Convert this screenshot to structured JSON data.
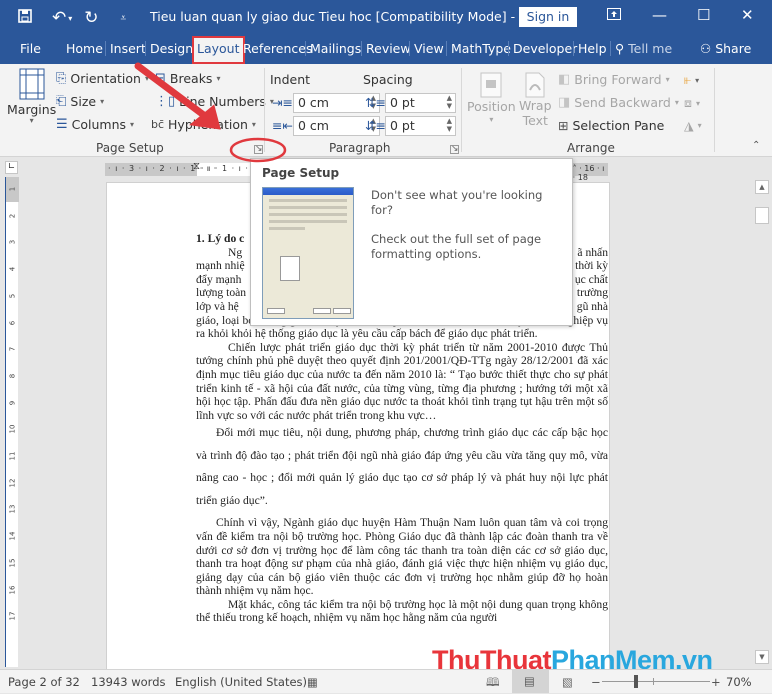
{
  "window": {
    "title": "Tieu luan quan ly giao duc Tieu hoc [Compatibility Mode]  -  Word",
    "sign_in": "Sign in",
    "qat": {
      "save_icon": "save-icon",
      "undo_icon": "undo-icon",
      "redo_icon": "redo-icon",
      "customize_icon": "customize-qat-icon"
    }
  },
  "tabs": [
    {
      "label": "File"
    },
    {
      "label": "Home"
    },
    {
      "label": "Insert"
    },
    {
      "label": "Design"
    },
    {
      "label": "Layout",
      "active": true
    },
    {
      "label": "References"
    },
    {
      "label": "Mailings"
    },
    {
      "label": "Review"
    },
    {
      "label": "View"
    },
    {
      "label": "MathType"
    },
    {
      "label": "Developer"
    },
    {
      "label": "Help"
    }
  ],
  "tell_me": "Tell me",
  "share": "Share",
  "ribbon": {
    "page_setup": {
      "label": "Page Setup",
      "margins": "Margins",
      "orientation": "Orientation",
      "size": "Size",
      "columns": "Columns",
      "breaks": "Breaks",
      "line_numbers": "Line Numbers",
      "hyphenation": "Hyphenation"
    },
    "paragraph": {
      "label": "Paragraph",
      "indent_label": "Indent",
      "spacing_label": "Spacing",
      "indent_left": "0 cm",
      "indent_right": "0 cm",
      "spacing_before": "0 pt",
      "spacing_after": "0 pt"
    },
    "arrange": {
      "label": "Arrange",
      "position": "Position",
      "wrap_text_1": "Wrap",
      "wrap_text_2": "Text",
      "bring_forward": "Bring Forward",
      "send_backward": "Send Backward",
      "selection_pane": "Selection Pane"
    }
  },
  "ruler": {
    "h_left": "· ı · 3 · ı · 2 · ı · 1 · ı ·",
    "h_mid": "· ı · 1 · ı · 2",
    "h_right": "ı · 15 · ˄ · 16 · ı · 17 · ı · 18",
    "v_labels": [
      "1",
      "2",
      "3",
      "4",
      "5",
      "6",
      "7",
      "8",
      "9",
      "10",
      "11",
      "12",
      "13",
      "14",
      "15",
      "16",
      "17"
    ]
  },
  "popup": {
    "title": "Page Setup",
    "line1": "Don't see what you're looking for?",
    "line2": "Check out the full set of page formatting options."
  },
  "document": {
    "heading": "1. Lý do c",
    "p1_lines": [
      "Ng                                                                           ã nhấn",
      "mạnh nhiệ                                                                  thời kỳ",
      "đẩy mạnh                                                                    ục chất",
      "lượng toàn                                                                  trường",
      "lớp và hệ                                                                    gũ nhà"
    ],
    "p1_rest": "giáo, loại bỏ những giáo viên yếu kém về phẩm chất, đạo đức và chuyên môn nghiệp vụ ra khỏi khỏi hệ thống giáo dục là yêu cầu cấp bách để giáo dục phát triển.",
    "p2": "Chiến lược phát triển giáo dục thời kỳ phát triển từ năm 2001-2010 được Thủ tướng chính phủ phê duyệt theo quyết định 201/2001/QĐ-TTg ngày 28/12/2001 đã xác định mục tiêu giáo dục của nước ta đến năm 2010 là: “ Tạo bước thiết thực cho sự phát triển kinh tế - xã hội của đất nước, của từng vùng, từng địa phương ; hướng tới một xã hội học tập. Phấn đấu đưa nền giáo dục nước ta thoát khỏi tình trạng tụt hậu trên một số lĩnh vực so với các nước phát triển trong khu vực…",
    "p3": "Đổi mới mục tiêu, nội dung, phương pháp, chương trình giáo dục các cấp bậc học và trình độ đào tạo ; phát triển đội ngũ nhà giáo đáp ứng yêu cầu vừa tăng quy mô, vừa nâng cao - học ; đổi mới quản lý giáo dục tạo cơ sở pháp lý và phát huy nội lực phát triển giáo dục”.",
    "p4": "Chính vì vậy, Ngành giáo dục huyện Hàm Thuận Nam luôn quan tâm và coi trọng vấn đề kiểm tra nội bộ trường học. Phòng Giáo dục đã thành lập các đoàn thanh tra về dưới cơ sở đơn vị trường học để làm công tác thanh tra toàn diện các cơ sở giáo dục, thanh tra hoạt động sư phạm của nhà     giáo, đánh giá việc thực hiện nhiệm vụ giáo dục, giảng dạy của cán bộ giáo viên thuộc các đơn vị trường học nhằm giúp đỡ họ hoàn thành nhiệm vụ năm học.",
    "p5": "Mặt khác, công tác kiểm tra nội bộ trường học là một nội dung quan trọng không thể thiếu trong kế hoạch, nhiệm vụ năm học hằng năm của người"
  },
  "watermark": {
    "part1": "ThuThuat",
    "part2": "PhanMem.vn"
  },
  "status": {
    "page": "Page 2 of 32",
    "words": "13943 words",
    "language": "English (United States)",
    "zoom": "70%",
    "zoom_level_percent": 70
  },
  "colors": {
    "accent": "#2b579a",
    "highlight_red": "#e0393e"
  }
}
